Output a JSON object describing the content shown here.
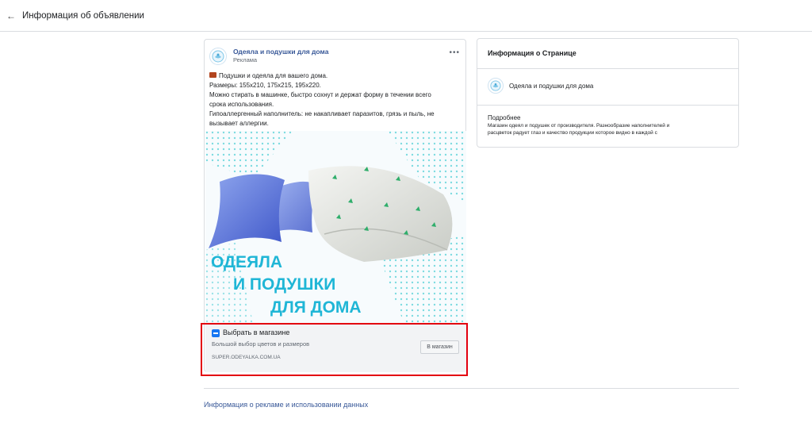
{
  "header": {
    "back_glyph": "←",
    "title": "Информация об объявлении"
  },
  "ad": {
    "page_name": "Одеяла и подушки для дома",
    "sponsored": "Реклама",
    "menu_glyph": "•••",
    "text_lines": [
      "Подушки и одеяла для вашего дома.",
      "Размеры: 155x210, 175x215, 195x220.",
      "Можно стирать в машинке, быстро сохнут и держат форму в течении всего",
      "срока использования.",
      "Гипоаллергенный наполнитель: не накапливает паразитов, грязь и пыль, не",
      "вызывает аллергии."
    ],
    "image_text": [
      "ОДЕЯЛА",
      "И ПОДУШКИ",
      "ДЛЯ ДОМА"
    ],
    "cta": {
      "title": "Выбрать в магазине",
      "description": "Большой выбор цветов и размеров",
      "url": "SUPER.ODEYALKA.COM.UA",
      "button_label": "В магазин"
    }
  },
  "page_info": {
    "title": "Информация о Странице",
    "page_name": "Одеяла и подушки для дома",
    "more_label": "Подробнее",
    "description_lines": [
      "Магазин одеял и подушек от производителя. Разнообразие наполнителей и",
      "расцветок радует глаз и качество продукции которое видно в каждой с"
    ]
  },
  "footer": {
    "link": "Информация о рекламе и использовании данных"
  },
  "colors": {
    "link_blue": "#385898",
    "accent_blue": "#1877f2",
    "highlight_red": "#e3000f",
    "headline_cyan": "#1fb6d6"
  },
  "icons": [
    "back-arrow-icon",
    "page-logo-icon",
    "more-dots-icon",
    "bed-icon",
    "shop-icon"
  ]
}
